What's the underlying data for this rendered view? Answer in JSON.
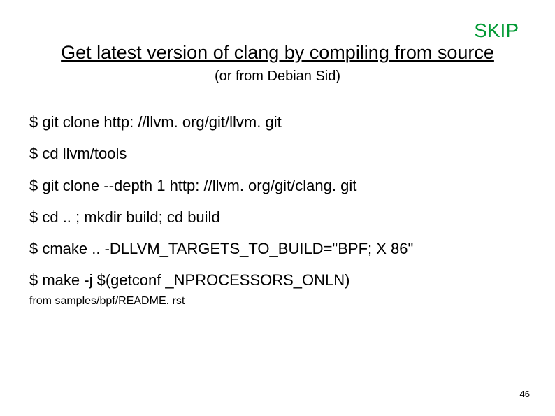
{
  "skip_label": "SKIP",
  "title": "Get latest version of clang by compiling from source",
  "subtitle": "(or from Debian Sid)",
  "commands": [
    "$ git clone http: //llvm. org/git/llvm. git",
    "$ cd llvm/tools",
    "$ git clone --depth 1 http: //llvm. org/git/clang. git",
    "$ cd .. ; mkdir build; cd build",
    "$ cmake .. -DLLVM_TARGETS_TO_BUILD=\"BPF; X 86\"",
    "$ make -j $(getconf _NPROCESSORS_ONLN)"
  ],
  "footnote": "from samples/bpf/README. rst",
  "page_number": "46"
}
